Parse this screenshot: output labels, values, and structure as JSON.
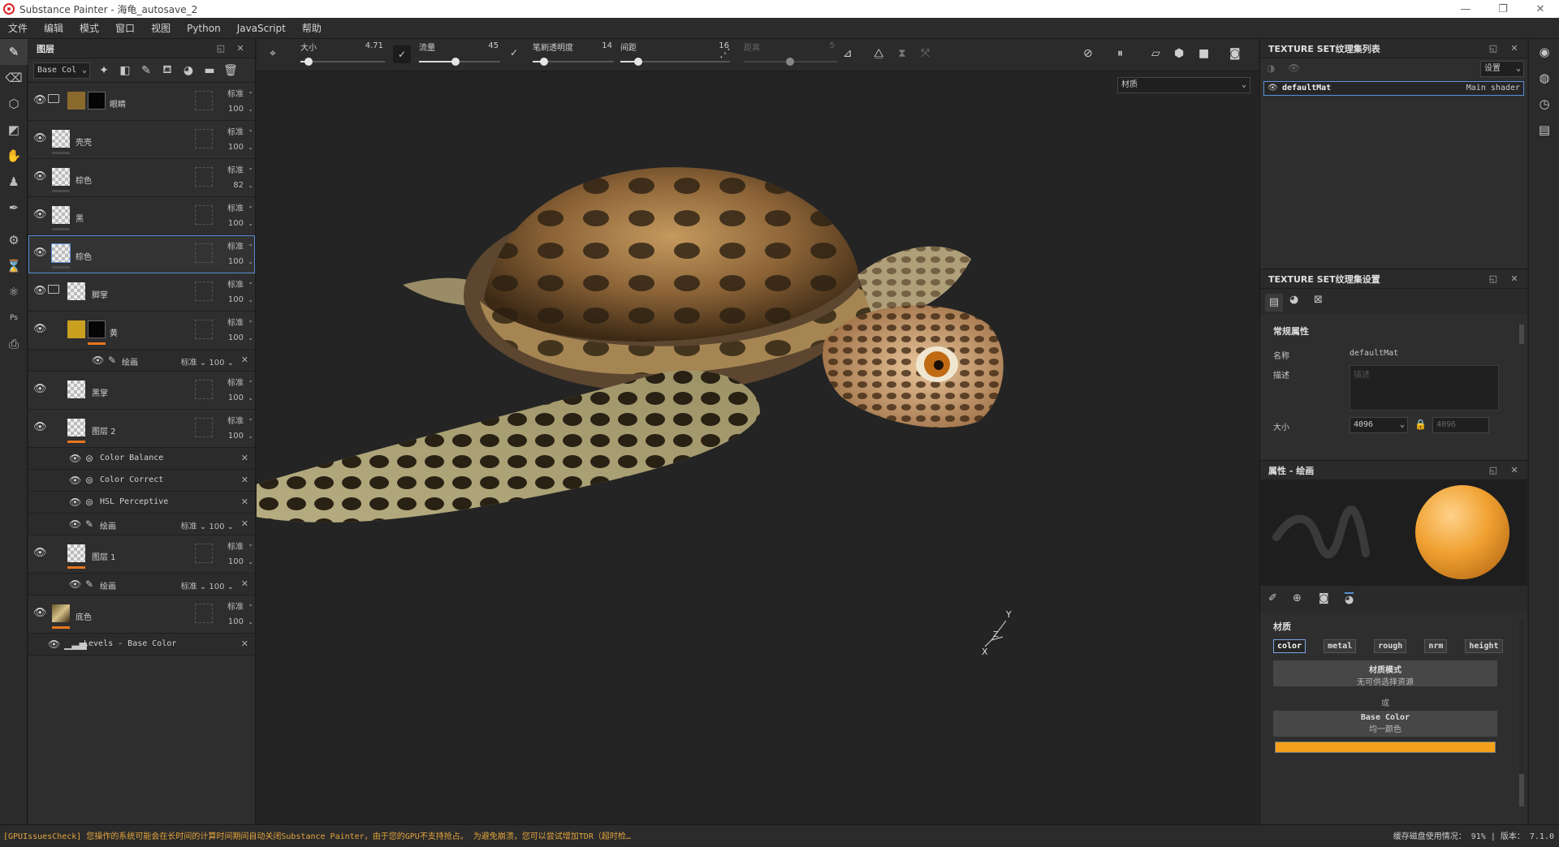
{
  "window": {
    "title": "Substance Painter - 海龟_autosave_2"
  },
  "menu": [
    "文件",
    "编辑",
    "模式",
    "窗口",
    "视图",
    "Python",
    "JavaScript",
    "帮助"
  ],
  "layers_panel": {
    "title": "图层",
    "channel_select": "Base Col",
    "layers": [
      {
        "name": "眼睛",
        "blend": "标准",
        "opacity": "100",
        "type": "folder"
      },
      {
        "name": "壳壳",
        "blend": "标准",
        "opacity": "100"
      },
      {
        "name": "棕色",
        "blend": "标准",
        "opacity": "82"
      },
      {
        "name": "黑",
        "blend": "标准",
        "opacity": "100"
      },
      {
        "name": "棕色",
        "blend": "标准",
        "opacity": "100",
        "selected": true
      },
      {
        "name": "脚掌",
        "blend": "标准",
        "opacity": "100",
        "type": "folder"
      },
      {
        "name": "黄",
        "blend": "标准",
        "opacity": "100"
      },
      {
        "name": "黑掌",
        "blend": "标准",
        "opacity": "100"
      },
      {
        "name": "图层 2",
        "blend": "标准",
        "opacity": "100"
      },
      {
        "name": "图层 1",
        "blend": "标准",
        "opacity": "100"
      },
      {
        "name": "底色",
        "blend": "标准",
        "opacity": "100"
      }
    ],
    "sub_paint": {
      "name": "绘画",
      "blend": "标准",
      "opacity": "100"
    },
    "effects_layer2": [
      "Color Balance",
      "Color Correct",
      "HSL Perceptive"
    ],
    "levels": "Levels - Base Color"
  },
  "toolbar": {
    "size_label": "大小",
    "size_value": "4.71",
    "flow_label": "流量",
    "flow_value": "45",
    "stroke_opacity_label": "笔刷透明度",
    "stroke_opacity_value": "14",
    "spacing_label": "间距",
    "spacing_value": "16",
    "distance_label": "距离",
    "distance_value": "5",
    "material_select": "材质"
  },
  "texture_set_list": {
    "title": "TEXTURE SET纹理集列表",
    "settings_label": "设置",
    "item_name": "defaultMat",
    "item_shader": "Main shader"
  },
  "texture_set_settings": {
    "title": "TEXTURE SET纹理集设置",
    "section": "常规属性",
    "name_label": "名称",
    "name_value": "defaultMat",
    "desc_label": "描述",
    "desc_placeholder": "描述",
    "size_label": "大小",
    "size_value": "4096",
    "size_locked_value": "4096"
  },
  "properties": {
    "title": "属性 - 绘画",
    "section": "材质",
    "channels": [
      "color",
      "metal",
      "rough",
      "nrm",
      "height"
    ],
    "material_mode_label": "材质模式",
    "material_mode_value": "无可供选择资源",
    "or_label": "或",
    "base_color_label": "Base Color",
    "base_color_value": "均一颜色",
    "base_color_swatch": "#f5a01a"
  },
  "status": {
    "warning": "[GPUIssuesCheck] 您操作的系统可能会在长时间的计算时间期间自动关闭Substance Painter，由于您的GPU不支持抢占。 为避免崩溃，您可以尝试增加TDR（超时检…",
    "cache": "缓存磁盘使用情况：  91%  |  版本：  7.1.0"
  },
  "colors": {
    "accent_orange": "#e7761e",
    "selection_blue": "#5b8fd6",
    "brush_ball": "#f0a030"
  }
}
